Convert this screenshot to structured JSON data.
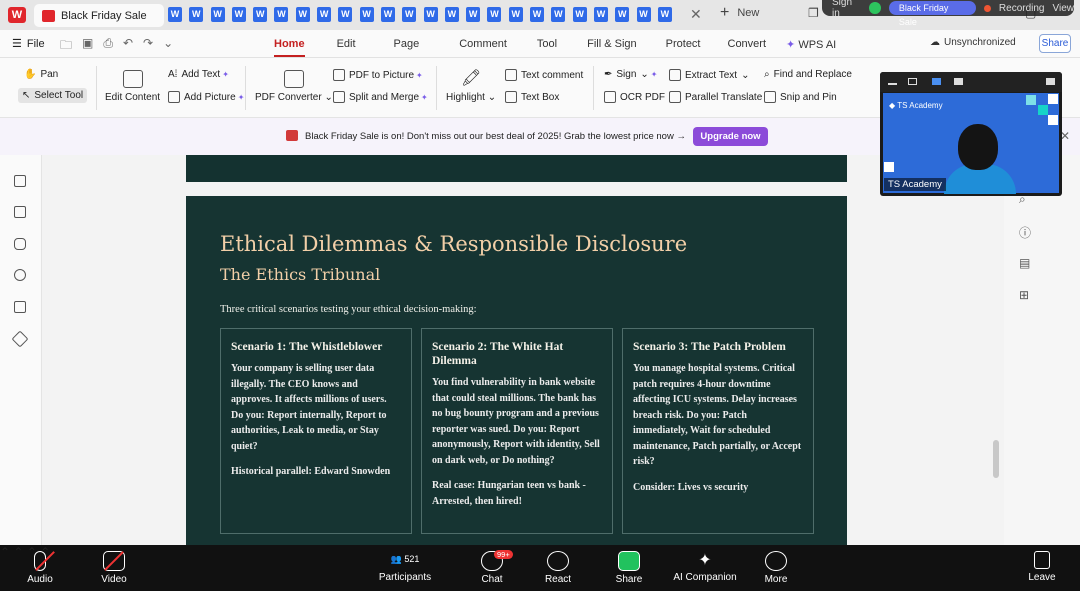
{
  "window": {
    "app_logo": "W",
    "active_tab": "Black Friday Sale",
    "doc_tab_letter": "W",
    "new_tab": "New"
  },
  "meeting_top": {
    "sign_in": "Sign in",
    "pill": "Black Friday Sale",
    "recording": "Recording",
    "view": "View"
  },
  "menu": {
    "file": "File",
    "tabs": [
      "Home",
      "Edit",
      "Page",
      "Comment",
      "Tool",
      "Fill & Sign",
      "Protect",
      "Convert",
      "WPS AI"
    ],
    "sync_status": "Unsynchronized",
    "share": "Share"
  },
  "ribbon": {
    "pan": "Pan",
    "select_tool": "Select Tool",
    "edit_content": "Edit Content",
    "add_text": "Add Text",
    "add_picture": "Add Picture",
    "pdf_converter": "PDF Converter",
    "pdf_to_picture": "PDF to Picture",
    "split_merge": "Split and Merge",
    "highlight": "Highlight",
    "text_comment": "Text comment",
    "text_box": "Text Box",
    "sign": "Sign",
    "ocr_pdf": "OCR PDF",
    "extract_text": "Extract Text",
    "parallel_translate": "Parallel Translate",
    "find_replace": "Find and Replace",
    "snip_pin": "Snip and Pin"
  },
  "promo": {
    "text": "Black Friday Sale is on! Don't miss out our best deal of 2025! Grab the lowest price now →",
    "button": "Upgrade now"
  },
  "slide": {
    "title": "Ethical Dilemmas & Responsible Disclosure",
    "subtitle": "The Ethics Tribunal",
    "intro": "Three critical scenarios testing your ethical decision-making:",
    "cards": [
      {
        "title": "Scenario 1: The Whistleblower",
        "body": "Your company is selling user data illegally. The CEO knows and approves. It affects millions of users. Do you: Report internally, Report to authorities, Leak to media, or Stay quiet?",
        "note": "Historical parallel: Edward Snowden"
      },
      {
        "title": "Scenario 2: The White Hat Dilemma",
        "body": "You find vulnerability in bank website that could steal millions. The bank has no bug bounty program and a previous reporter was sued. Do you: Report anonymously, Report with identity, Sell on dark web, or Do nothing?",
        "note": "Real case: Hungarian teen vs bank - Arrested, then hired!"
      },
      {
        "title": "Scenario 3: The Patch Problem",
        "body": "You manage hospital systems. Critical patch requires 4-hour downtime affecting ICU systems. Delay increases breach risk. Do you: Patch immediately, Wait for scheduled maintenance, Patch partially, or Accept risk?",
        "note": "Consider: Lives vs security"
      }
    ]
  },
  "video": {
    "brand": "TS Academy",
    "name": "TS Academy"
  },
  "meetbar": {
    "audio": "Audio",
    "video": "Video",
    "participants": "Participants",
    "participants_count": "521",
    "chat": "Chat",
    "chat_badge": "99+",
    "react": "React",
    "share": "Share",
    "ai": "AI Companion",
    "more": "More",
    "leave": "Leave"
  },
  "colors": {
    "slide_bg": "#163432",
    "title_accent": "#f2cfa8",
    "home_tab": "#c42020",
    "upgrade": "#8c4bd9",
    "share_green": "#21c25e"
  }
}
